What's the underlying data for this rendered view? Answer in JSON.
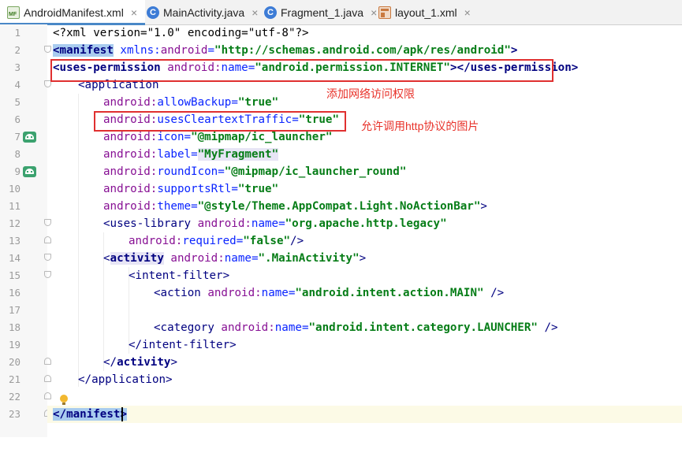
{
  "tabs": [
    {
      "label": "AndroidManifest.xml",
      "icon": "manifest-file-icon",
      "badge": "MF",
      "active": true
    },
    {
      "label": "MainActivity.java",
      "icon": "java-class-icon",
      "badge": "C",
      "active": false
    },
    {
      "label": "Fragment_1.java",
      "icon": "java-class-icon",
      "badge": "C",
      "active": false
    },
    {
      "label": "layout_1.xml",
      "icon": "layout-file-icon",
      "active": false
    }
  ],
  "close_glyph": "×",
  "line_numbers": [
    "1",
    "2",
    "3",
    "4",
    "5",
    "6",
    "7",
    "8",
    "9",
    "10",
    "11",
    "12",
    "13",
    "14",
    "15",
    "16",
    "17",
    "18",
    "19",
    "20",
    "21",
    "22",
    "23"
  ],
  "code": {
    "l1": {
      "text": "<?xml version=\"1.0\" encoding=\"utf-8\"?>"
    },
    "l2": {
      "open": "<",
      "tag": "manifest",
      "attr_ns": " xmlns:",
      "attr": "android",
      "eq": "=",
      "val": "\"http://schemas.android.com/apk/res/android\"",
      "close": ">"
    },
    "l3": {
      "open": "<",
      "tag": "uses-permission",
      "ns": " android:",
      "attr": "name",
      "eq": "=",
      "val": "\"android.permission.INTERNET\"",
      "close": "></",
      "tag2": "uses-permission",
      "end": ">"
    },
    "l4": {
      "open": "<",
      "tag": "application"
    },
    "l5": {
      "ns": "android:",
      "attr": "allowBackup",
      "eq": "=",
      "val": "\"true\""
    },
    "l6": {
      "ns": "android:",
      "attr": "usesCleartextTraffic",
      "eq": "=",
      "val": "\"true\""
    },
    "l7": {
      "ns": "android:",
      "attr": "icon",
      "eq": "=",
      "val": "\"@mipmap/ic_launcher\""
    },
    "l8": {
      "ns": "android:",
      "attr": "label",
      "eq": "=",
      "val": "\"MyFragment\""
    },
    "l9": {
      "ns": "android:",
      "attr": "roundIcon",
      "eq": "=",
      "val": "\"@mipmap/ic_launcher_round\""
    },
    "l10": {
      "ns": "android:",
      "attr": "supportsRtl",
      "eq": "=",
      "val": "\"true\""
    },
    "l11": {
      "ns": "android:",
      "attr": "theme",
      "eq": "=",
      "val": "\"@style/Theme.AppCompat.Light.NoActionBar\"",
      "close": ">"
    },
    "l12": {
      "open": "<",
      "tag": "uses-library",
      "ns": " android:",
      "attr": "name",
      "eq": "=",
      "val": "\"org.apache.http.legacy\""
    },
    "l13": {
      "ns": "android:",
      "attr": "required",
      "eq": "=",
      "val": "\"false\"",
      "close": "/>"
    },
    "l14": {
      "open": "<",
      "tag": "activity",
      "ns": " android:",
      "attr": "name",
      "eq": "=",
      "val": "\".MainActivity\"",
      "close": ">"
    },
    "l15": {
      "open": "<",
      "tag": "intent-filter",
      "close": ">"
    },
    "l16": {
      "open": "<",
      "tag": "action",
      "ns": " android:",
      "attr": "name",
      "eq": "=",
      "val": "\"android.intent.action.MAIN\"",
      "close": " />"
    },
    "l18": {
      "open": "<",
      "tag": "category",
      "ns": " android:",
      "attr": "name",
      "eq": "=",
      "val": "\"android.intent.category.LAUNCHER\"",
      "close": " />"
    },
    "l19": {
      "text": "</intent-filter>"
    },
    "l20": {
      "open": "</",
      "tag": "activity",
      "close": ">"
    },
    "l21": {
      "text": "</application>"
    },
    "l23": {
      "open": "</",
      "tag": "manifest",
      "close": ">"
    }
  },
  "annotations": {
    "internet_note": "添加网络访问权限",
    "cleartext_note": "允许调用http协议的图片"
  },
  "gutter_icons": [
    "android-icon",
    "android-icon",
    "lightbulb-icon"
  ],
  "colors": {
    "annotation": "#e03030",
    "tag": "#000080",
    "attribute": "#0a24ff",
    "namespace": "#871094",
    "string": "#067d17"
  }
}
